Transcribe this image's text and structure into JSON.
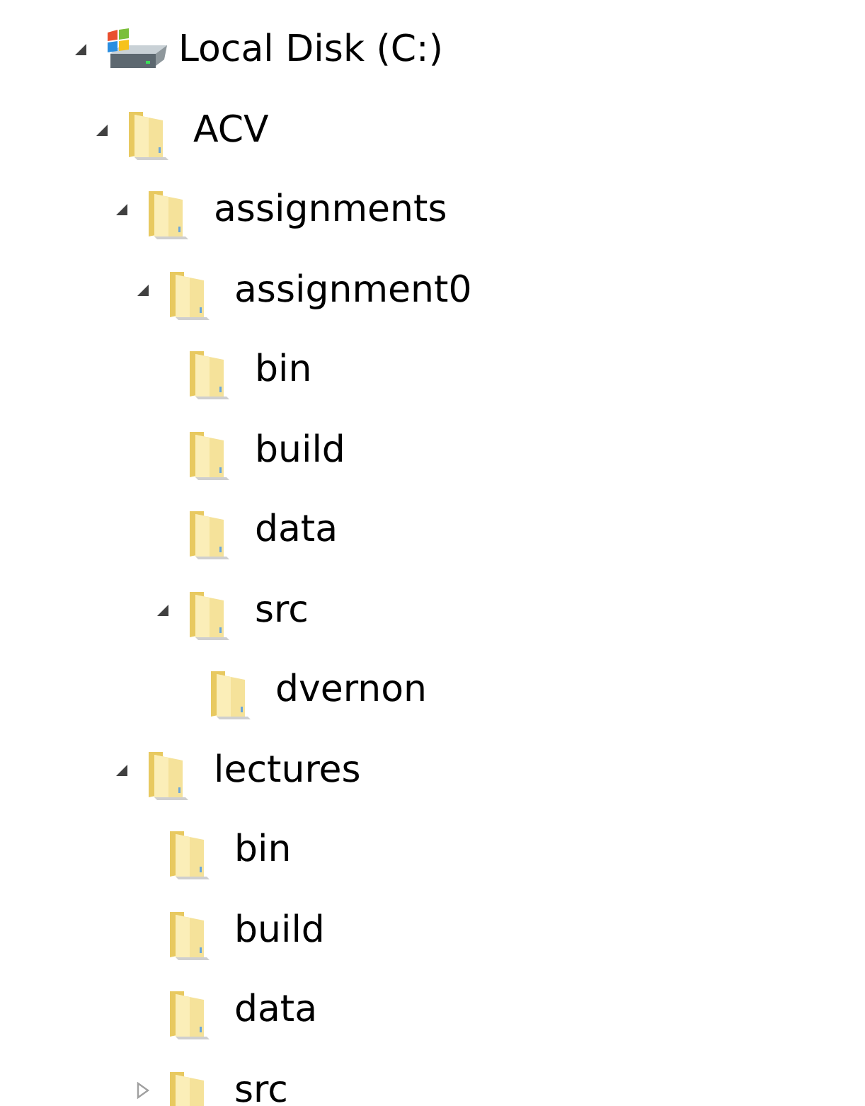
{
  "tree": [
    {
      "label": "Local Disk (C:)",
      "kind": "drive",
      "expanded": true,
      "children": [
        {
          "label": "ACV",
          "kind": "folder",
          "expanded": true,
          "children": [
            {
              "label": "assignments",
              "kind": "folder",
              "expanded": true,
              "children": [
                {
                  "label": "assignment0",
                  "kind": "folder",
                  "expanded": true,
                  "children": [
                    {
                      "label": "bin",
                      "kind": "folder"
                    },
                    {
                      "label": "build",
                      "kind": "folder"
                    },
                    {
                      "label": "data",
                      "kind": "folder"
                    },
                    {
                      "label": "src",
                      "kind": "folder",
                      "expanded": true,
                      "children": [
                        {
                          "label": "dvernon",
                          "kind": "folder"
                        }
                      ]
                    }
                  ]
                }
              ]
            },
            {
              "label": "lectures",
              "kind": "folder",
              "expanded": true,
              "children": [
                {
                  "label": "bin",
                  "kind": "folder"
                },
                {
                  "label": "build",
                  "kind": "folder"
                },
                {
                  "label": "data",
                  "kind": "folder"
                },
                {
                  "label": "src",
                  "kind": "folder",
                  "expanded": false
                }
              ]
            }
          ]
        }
      ]
    }
  ]
}
